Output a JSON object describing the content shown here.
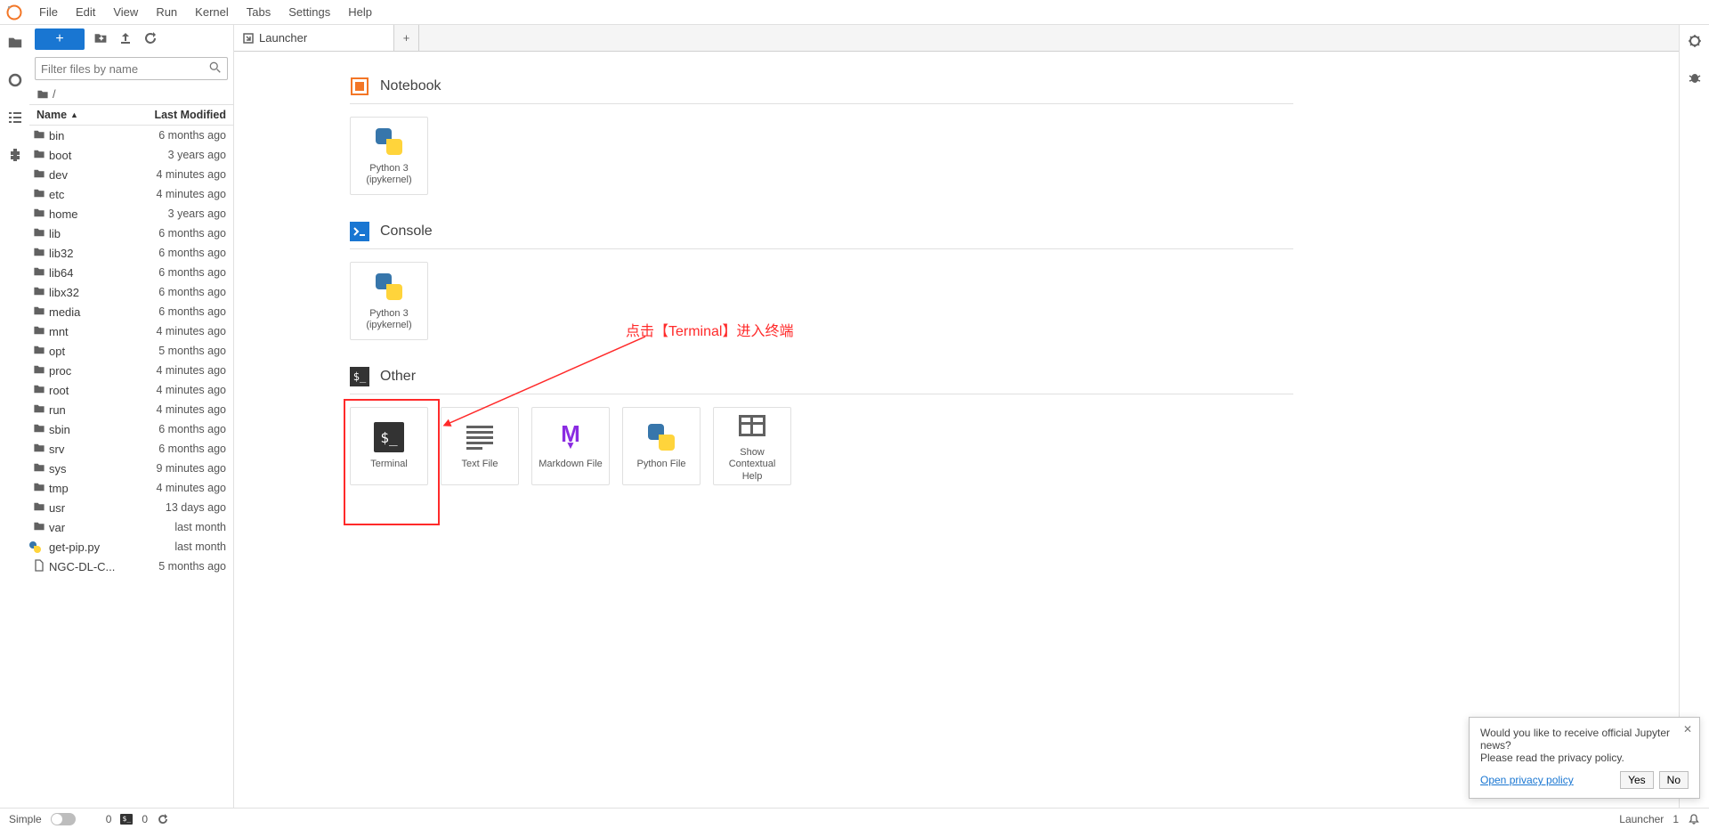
{
  "menubar": [
    "File",
    "Edit",
    "View",
    "Run",
    "Kernel",
    "Tabs",
    "Settings",
    "Help"
  ],
  "filter_placeholder": "Filter files by name",
  "breadcrumb": "/",
  "fb_headers": {
    "name": "Name",
    "modified": "Last Modified"
  },
  "files": [
    {
      "icon": "folder",
      "name": "bin",
      "mod": "6 months ago"
    },
    {
      "icon": "folder",
      "name": "boot",
      "mod": "3 years ago"
    },
    {
      "icon": "folder",
      "name": "dev",
      "mod": "4 minutes ago"
    },
    {
      "icon": "folder",
      "name": "etc",
      "mod": "4 minutes ago"
    },
    {
      "icon": "folder",
      "name": "home",
      "mod": "3 years ago"
    },
    {
      "icon": "folder",
      "name": "lib",
      "mod": "6 months ago"
    },
    {
      "icon": "folder",
      "name": "lib32",
      "mod": "6 months ago"
    },
    {
      "icon": "folder",
      "name": "lib64",
      "mod": "6 months ago"
    },
    {
      "icon": "folder",
      "name": "libx32",
      "mod": "6 months ago"
    },
    {
      "icon": "folder",
      "name": "media",
      "mod": "6 months ago"
    },
    {
      "icon": "folder",
      "name": "mnt",
      "mod": "4 minutes ago"
    },
    {
      "icon": "folder",
      "name": "opt",
      "mod": "5 months ago"
    },
    {
      "icon": "folder",
      "name": "proc",
      "mod": "4 minutes ago"
    },
    {
      "icon": "folder",
      "name": "root",
      "mod": "4 minutes ago"
    },
    {
      "icon": "folder",
      "name": "run",
      "mod": "4 minutes ago"
    },
    {
      "icon": "folder",
      "name": "sbin",
      "mod": "6 months ago"
    },
    {
      "icon": "folder",
      "name": "srv",
      "mod": "6 months ago"
    },
    {
      "icon": "folder",
      "name": "sys",
      "mod": "9 minutes ago"
    },
    {
      "icon": "folder",
      "name": "tmp",
      "mod": "4 minutes ago"
    },
    {
      "icon": "folder",
      "name": "usr",
      "mod": "13 days ago"
    },
    {
      "icon": "folder",
      "name": "var",
      "mod": "last month"
    },
    {
      "icon": "python",
      "name": "get-pip.py",
      "mod": "last month"
    },
    {
      "icon": "file",
      "name": "NGC-DL-C...",
      "mod": "5 months ago"
    }
  ],
  "tab_title": "Launcher",
  "sections": {
    "notebook": {
      "title": "Notebook",
      "card": "Python 3\n(ipykernel)"
    },
    "console": {
      "title": "Console",
      "card": "Python 3\n(ipykernel)"
    },
    "other": {
      "title": "Other",
      "cards": [
        {
          "key": "terminal",
          "label": "Terminal"
        },
        {
          "key": "text",
          "label": "Text File"
        },
        {
          "key": "markdown",
          "label": "Markdown File"
        },
        {
          "key": "python",
          "label": "Python File"
        },
        {
          "key": "help",
          "label": "Show\nContextual\nHelp"
        }
      ]
    }
  },
  "annotation_text": "点击【Terminal】进入终端",
  "popup": {
    "line1": "Would you like to receive official Jupyter news?",
    "line2": "Please read the privacy policy.",
    "link": "Open privacy policy",
    "yes": "Yes",
    "no": "No"
  },
  "statusbar": {
    "simple": "Simple",
    "count1": "0",
    "count2": "0",
    "mode": "Launcher",
    "right_num": "1"
  }
}
